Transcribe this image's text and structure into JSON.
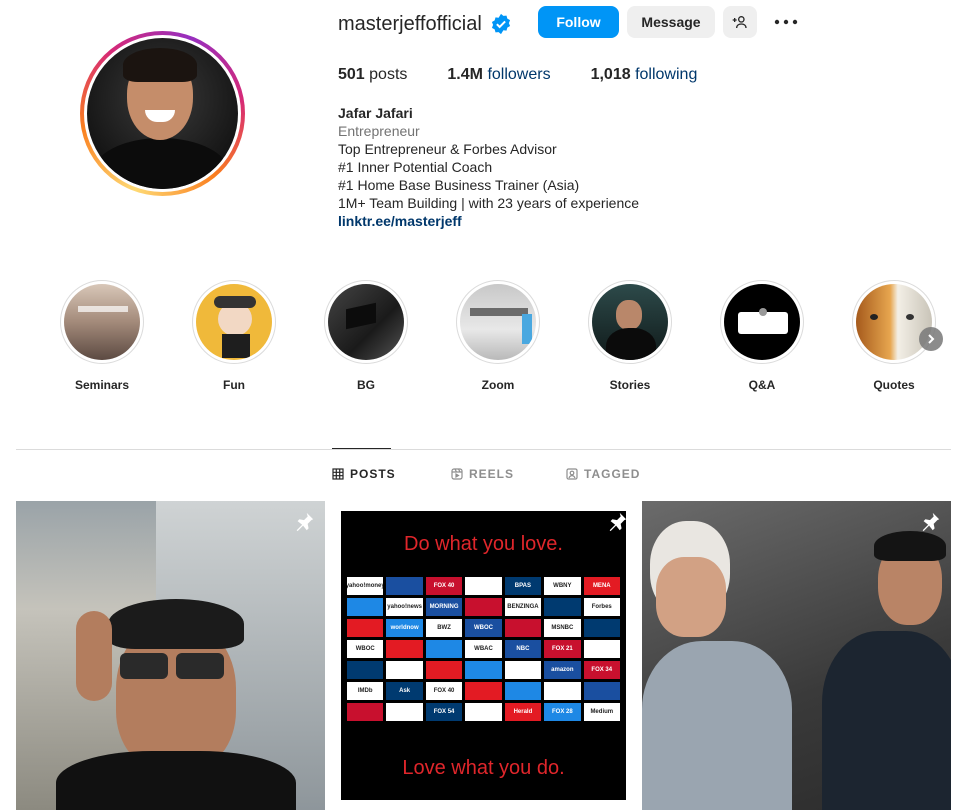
{
  "profile": {
    "username": "masterjeffofficial",
    "follow_label": "Follow",
    "message_label": "Message",
    "stats": {
      "posts_count": "501",
      "posts_label": "posts",
      "followers_count": "1.4M",
      "followers_label": "followers",
      "following_count": "1,018",
      "following_label": "following"
    },
    "bio": {
      "name": "Jafar Jafari",
      "category": "Entrepreneur",
      "lines": [
        "Top Entrepreneur & Forbes Advisor",
        "#1 Inner Potential Coach",
        "#1 Home Base Business Trainer (Asia)",
        "1M+ Team Building | with 23 years of experience"
      ],
      "link": "linktr.ee/masterjeff"
    }
  },
  "highlights": [
    {
      "label": "Seminars"
    },
    {
      "label": "Fun"
    },
    {
      "label": "BG"
    },
    {
      "label": "Zoom"
    },
    {
      "label": "Stories"
    },
    {
      "label": "Q&A"
    },
    {
      "label": "Quotes"
    }
  ],
  "tabs": [
    {
      "label": "POSTS",
      "active": true
    },
    {
      "label": "REELS",
      "active": false
    },
    {
      "label": "TAGGED",
      "active": false
    }
  ],
  "posts": {
    "post2_top": "Do what you love.",
    "post2_bottom": "Love what you do.",
    "post2_logos": [
      "yahoo!money",
      "",
      "FOX 40",
      "",
      "BPAS",
      "WBNY",
      "MENA",
      "",
      "yahoo!news",
      "MORNING",
      "",
      "BENZINGA",
      "",
      "Forbes",
      "",
      "worldnow",
      "BWZ",
      "WBOC",
      "",
      "MSNBC",
      "",
      "WBOC",
      "",
      "",
      "WBAC",
      "NBC",
      "FOX 21",
      "",
      "",
      "",
      "",
      "",
      "",
      "amazon",
      "FOX 34",
      "IMDb",
      "Ask",
      "FOX 40",
      "",
      "",
      "",
      "",
      "",
      "",
      "FOX 54",
      "",
      "Herald",
      "FOX 28",
      "Medium"
    ]
  },
  "colors": {
    "accent": "#0095f6",
    "link": "#00376b",
    "quote_red": "#e0262b"
  }
}
